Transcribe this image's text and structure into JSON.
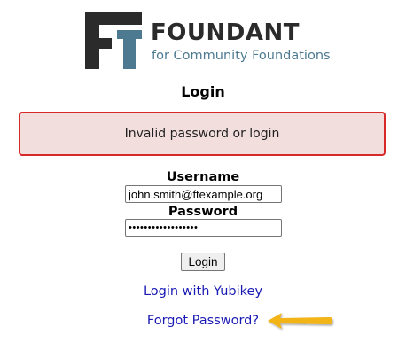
{
  "brand": {
    "name": "FOUNDANT",
    "tagline": "for Community Foundations",
    "colors": {
      "dark": "#2b2b2b",
      "accent": "#4e7a91"
    }
  },
  "page": {
    "heading": "Login"
  },
  "alert": {
    "message": "Invalid password or login",
    "border_color": "#d62a2a",
    "background": "#f3dede"
  },
  "form": {
    "username_label": "Username",
    "username_value": "john.smith@ftexample.org",
    "password_label": "Password",
    "password_value": "••••••••••••••••••",
    "login_button_label": "Login"
  },
  "links": {
    "yubikey": "Login with Yubikey",
    "forgot_password": "Forgot Password?",
    "color": "#1a1ab4"
  },
  "annotation": {
    "arrow_icon": "arrow-left-icon",
    "arrow_color": "#f2b418"
  }
}
